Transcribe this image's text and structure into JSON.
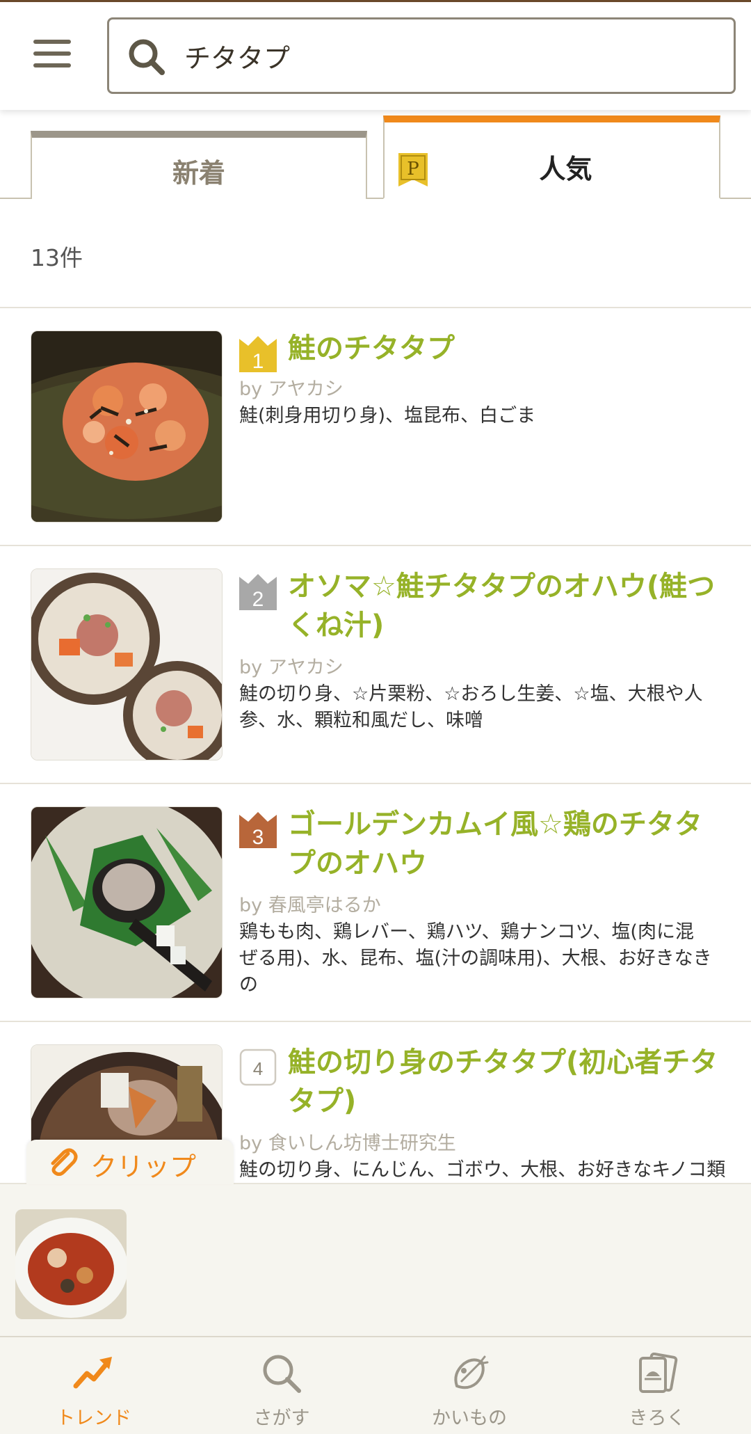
{
  "header": {
    "search": {
      "value": "チタタプ",
      "icon": "search-icon"
    },
    "menu_icon": "hamburger-menu-icon"
  },
  "tabs": [
    {
      "label": "新着",
      "active": false
    },
    {
      "label": "人気",
      "active": true,
      "badge": "P"
    }
  ],
  "results": {
    "count_label": "13件",
    "items": [
      {
        "rank": "1",
        "title": "鮭のチタタプ",
        "author": "by アヤカシ",
        "ingredients": "鮭(刺身用切り身)、塩昆布、白ごま"
      },
      {
        "rank": "2",
        "title": "オソマ☆鮭チタタプのオハウ(鮭つくね汁)",
        "author": "by アヤカシ",
        "ingredients": "鮭の切り身、☆片栗粉、☆おろし生姜、☆塩、大根や人参、水、顆粒和風だし、味噌"
      },
      {
        "rank": "3",
        "title": "ゴールデンカムイ風☆鶏のチタタプのオハウ",
        "author": "by 春風亭はるか",
        "ingredients": "鶏もも肉、鶏レバー、鶏ハツ、鶏ナンコツ、塩(肉に混ぜる用)、水、昆布、塩(汁の調味用)、大根、お好きなきの"
      },
      {
        "rank": "4",
        "title": "鮭の切り身のチタタプ(初心者チタタプ)",
        "author": "by 食いしん坊博士研究生",
        "ingredients": "鮭の切り身、にんじん、ゴボウ、大根、お好きなキノコ類"
      }
    ]
  },
  "clip": {
    "label": "クリップ"
  },
  "bottom_nav": [
    {
      "label": "トレンド",
      "icon": "trend-icon",
      "active": true
    },
    {
      "label": "さがす",
      "icon": "search-icon",
      "active": false
    },
    {
      "label": "かいもの",
      "icon": "shopping-icon",
      "active": false
    },
    {
      "label": "きろく",
      "icon": "record-icon",
      "active": false
    }
  ],
  "colors": {
    "accent": "#f0891b",
    "title_green": "#96b228",
    "gold": "#e8c02a",
    "silver": "#a8a8a8",
    "bronze": "#b8663a"
  }
}
